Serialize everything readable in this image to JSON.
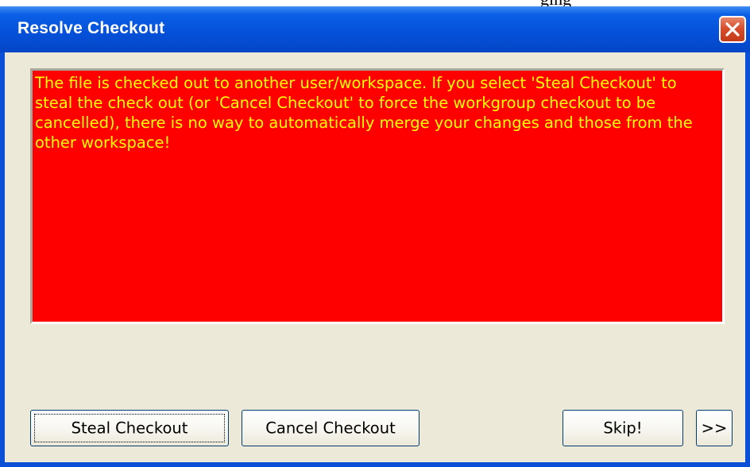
{
  "window": {
    "title": "Resolve Checkout",
    "top_clip_text": "ging"
  },
  "icons": {
    "close": "close-icon"
  },
  "message": {
    "text": "The file is checked out to another user/workspace. If you select 'Steal Checkout' to steal the check out (or 'Cancel Checkout' to force the workgroup checkout to be cancelled), there is no way to automatically merge your changes and those from the other workspace!",
    "background_color": "#ff0000",
    "text_color": "#ffff00"
  },
  "buttons": {
    "steal": "Steal Checkout",
    "cancel": "Cancel Checkout",
    "skip": "Skip!",
    "more": ">>"
  },
  "colors": {
    "titlebar": "#0550d8",
    "client_background": "#ece9d8",
    "close_button": "#d84e2c"
  }
}
